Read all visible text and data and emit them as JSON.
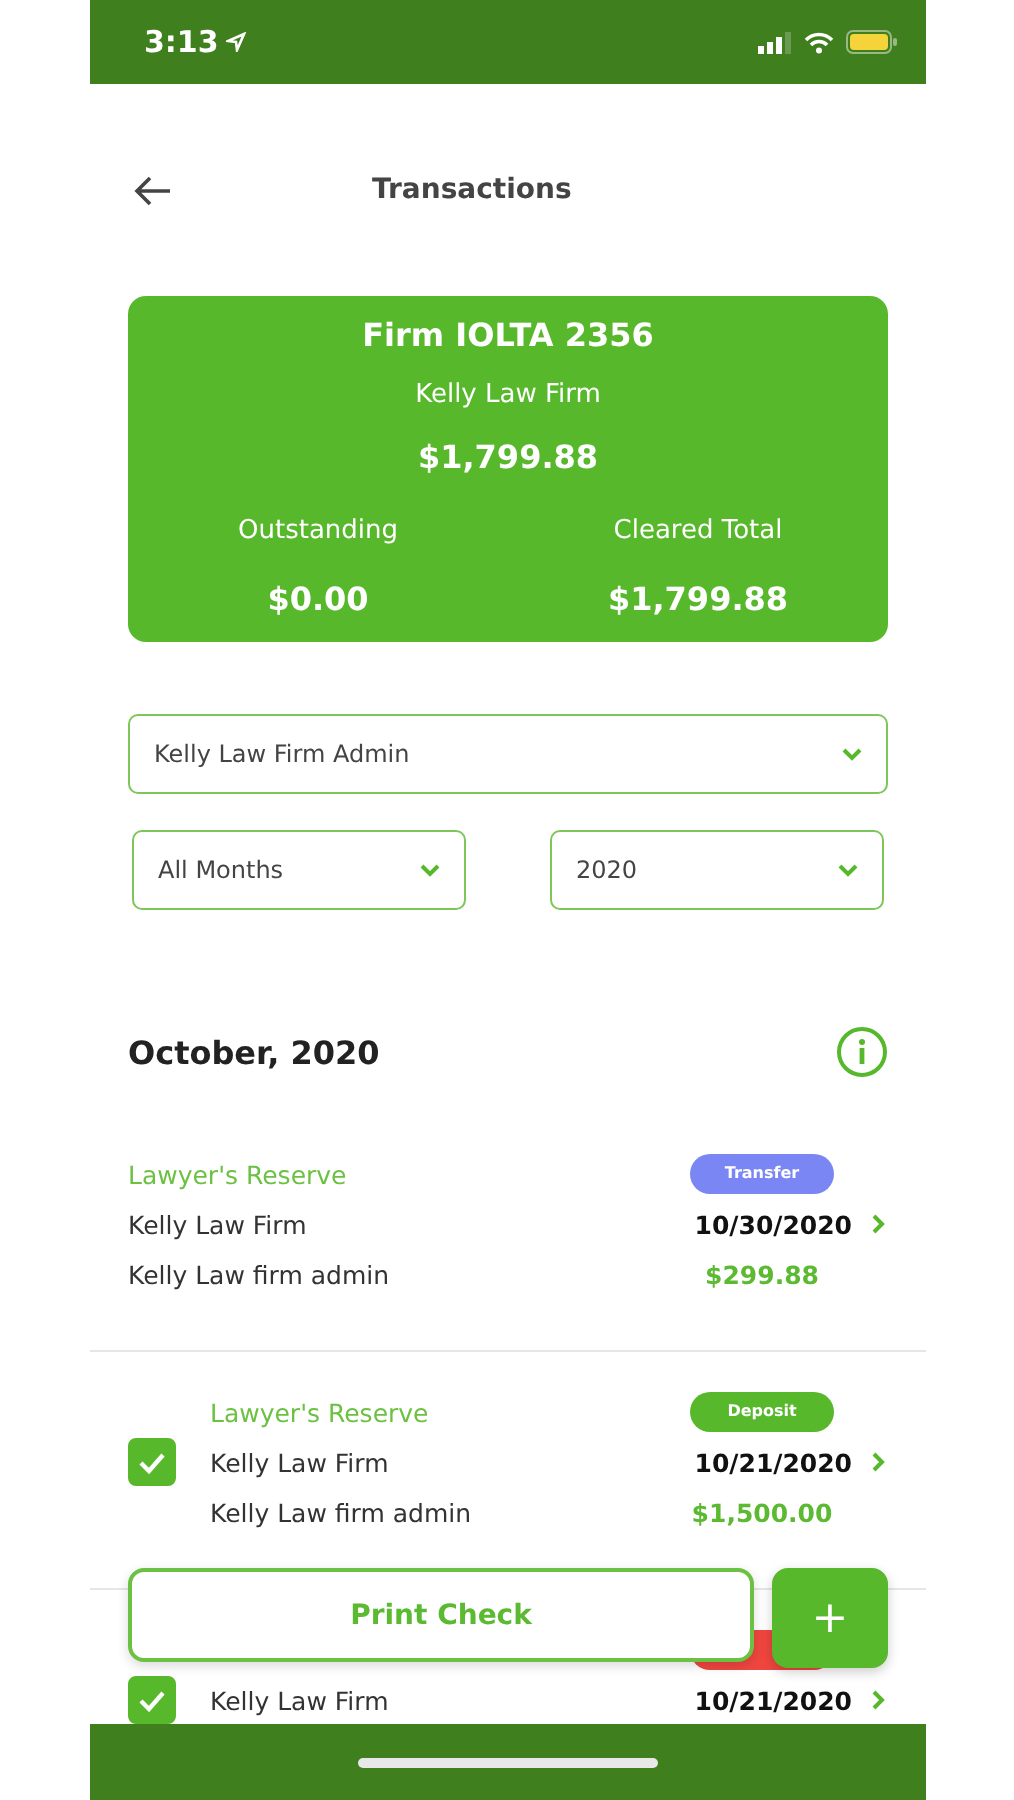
{
  "status_bar": {
    "time": "3:13"
  },
  "header": {
    "title": "Transactions"
  },
  "account": {
    "name": "Firm IOLTA 2356",
    "firm": "Kelly Law Firm",
    "balance": "$1,799.88",
    "outstanding_label": "Outstanding",
    "outstanding": "$0.00",
    "cleared_label": "Cleared Total",
    "cleared": "$1,799.88"
  },
  "filters": {
    "user": "Kelly Law Firm Admin",
    "month": "All Months",
    "year": "2020"
  },
  "month_heading": "October, 2020",
  "transactions": [
    {
      "kind": "plain",
      "category": "Lawyer's Reserve",
      "badge": "Transfer",
      "color": "#7b86f5",
      "payee": "Kelly Law Firm",
      "date": "10/30/2020",
      "user": "Kelly Law firm admin",
      "amount": "$299.88"
    },
    {
      "kind": "checkable",
      "checked": true,
      "category": "Lawyer's Reserve",
      "badge": "Deposit",
      "color": "#57b82c",
      "payee": "Kelly Law Firm",
      "date": "10/21/2020",
      "user": "Kelly Law firm admin",
      "amount": "$1,500.00"
    },
    {
      "kind": "checkable",
      "checked": true,
      "color": "#f0463f",
      "payee": "Kelly Law Firm",
      "date": "10/21/2020"
    }
  ],
  "actions": {
    "print": "Print Check",
    "add": "+"
  }
}
